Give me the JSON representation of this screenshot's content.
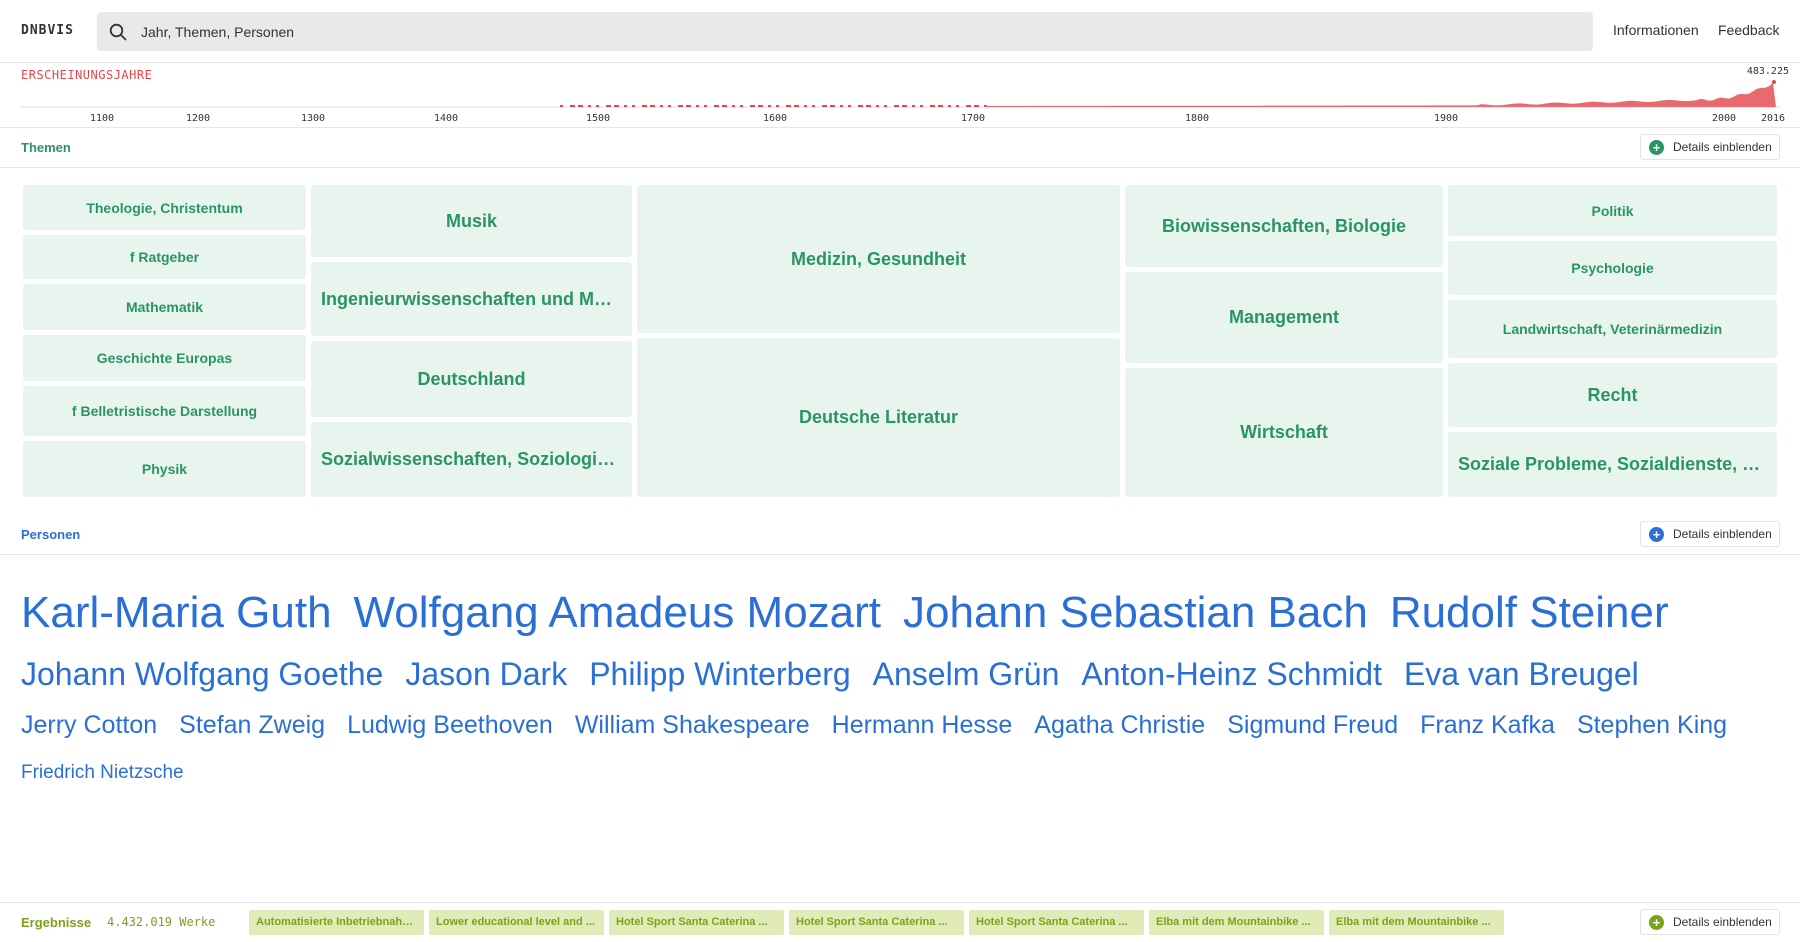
{
  "header": {
    "logo": "DNBVIS",
    "search_placeholder": "Jahr, Themen, Personen",
    "nav": [
      "Informationen",
      "Feedback"
    ]
  },
  "timeline": {
    "title": "ERSCHEINUNGSJAHRE",
    "max_label": "483.225",
    "color": "#e0484e",
    "ticks": [
      "1100",
      "1200",
      "1300",
      "1400",
      "1500",
      "1600",
      "1700",
      "1800",
      "1900",
      "2000",
      "2016"
    ]
  },
  "themen": {
    "title": "Themen",
    "color": "#2a9467",
    "details_label": "Details einblenden",
    "tiles": [
      "Theologie, Christentum",
      "f Ratgeber",
      "Mathematik",
      "Geschichte Europas",
      "f Belletristische Darstellung",
      "Physik",
      "Musik",
      "Ingenieurwissenschaften und Maschinenbau",
      "Deutschland",
      "Sozialwissenschaften, Soziologie, Anthropologie",
      "Medizin, Gesundheit",
      "Deutsche Literatur",
      "Biowissenschaften, Biologie",
      "Management",
      "Wirtschaft",
      "Politik",
      "Psychologie",
      "Landwirtschaft, Veterinärmedizin",
      "Recht",
      "Soziale Probleme, Sozialdienste, Versicherungen"
    ]
  },
  "personen": {
    "title": "Personen",
    "color": "#2a6fd6",
    "details_label": "Details einblenden",
    "rows": [
      [
        "Karl-Maria Guth",
        "Wolfgang Amadeus Mozart",
        "Johann Sebastian Bach",
        "Rudolf Steiner"
      ],
      [
        "Johann Wolfgang Goethe",
        "Jason Dark",
        "Philipp Winterberg",
        "Anselm Grün",
        "Anton-Heinz Schmidt",
        "Eva van Breugel"
      ],
      [
        "Jerry Cotton",
        "Stefan Zweig",
        "Ludwig Beethoven",
        "William Shakespeare",
        "Hermann Hesse",
        "Agatha Christie",
        "Sigmund Freud",
        "Franz Kafka",
        "Stephen King"
      ],
      [
        "Friedrich Nietzsche"
      ]
    ]
  },
  "ergebnisse": {
    "title": "Ergebnisse",
    "count": "4.432.019 Werke",
    "color": "#7aa21d",
    "details_label": "Details einblenden",
    "items": [
      "Automatisierte Inbetriebnahme",
      "Lower educational level and ...",
      "Hotel Sport Santa Caterina ...",
      "Hotel Sport Santa Caterina ...",
      "Hotel Sport Santa Caterina ...",
      "Elba mit dem Mountainbike ...",
      "Elba mit dem Mountainbike ..."
    ]
  }
}
